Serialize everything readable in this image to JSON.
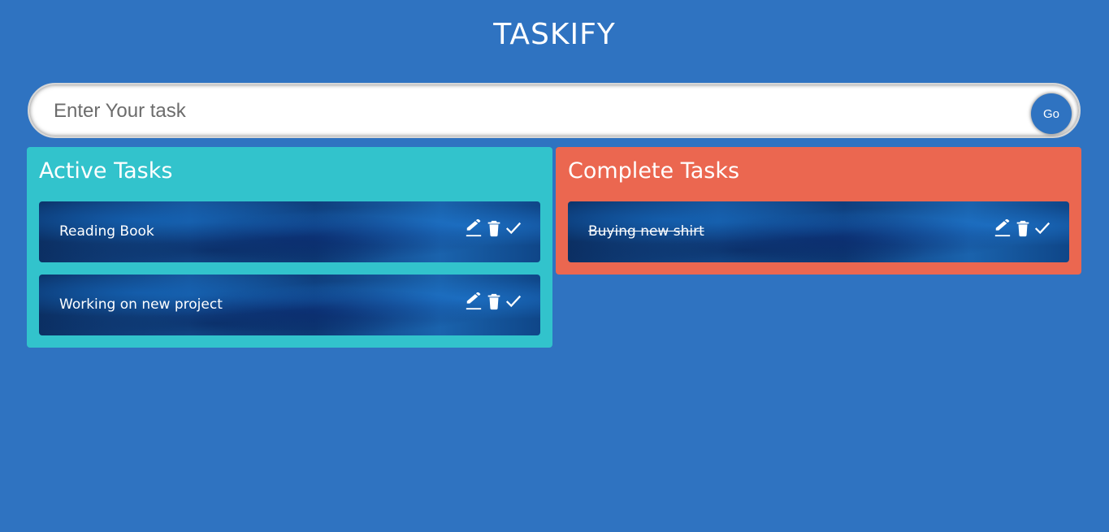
{
  "app": {
    "title": "TASKIFY"
  },
  "input": {
    "placeholder": "Enter Your task",
    "value": "",
    "go_label": "Go"
  },
  "active": {
    "title": "Active Tasks",
    "tasks": [
      {
        "text": "Reading Book"
      },
      {
        "text": "Working on new project"
      }
    ]
  },
  "complete": {
    "title": "Complete Tasks",
    "tasks": [
      {
        "text": "Buying new shirt"
      }
    ]
  },
  "icons": {
    "edit": "pencil-icon",
    "delete": "trash-icon",
    "done": "check-icon"
  },
  "colors": {
    "background": "#2f73c1",
    "active_panel": "#32c3cc",
    "complete_panel": "#eb6750",
    "go_button": "#2f73c1"
  }
}
